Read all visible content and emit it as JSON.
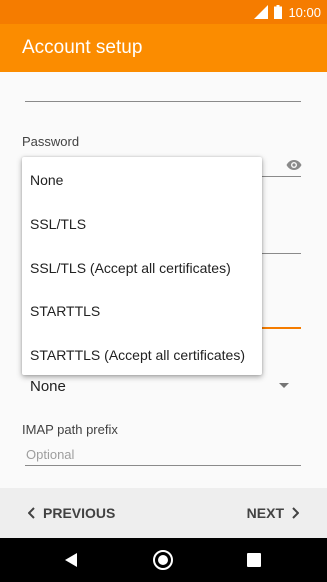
{
  "status_bar": {
    "time": "10:00"
  },
  "app_bar": {
    "title": "Account setup"
  },
  "form": {
    "password_label": "Password",
    "imap_prefix_label": "IMAP path prefix",
    "imap_prefix_placeholder": "Optional",
    "security_selected": "None"
  },
  "dropdown": {
    "options": [
      "None",
      "SSL/TLS",
      "SSL/TLS (Accept all certificates)",
      "STARTTLS",
      "STARTTLS (Accept all certificates)"
    ]
  },
  "footer": {
    "previous_label": "PREVIOUS",
    "next_label": "NEXT"
  },
  "colors": {
    "accent": "#fb8c00",
    "status_bar": "#f57c00"
  }
}
